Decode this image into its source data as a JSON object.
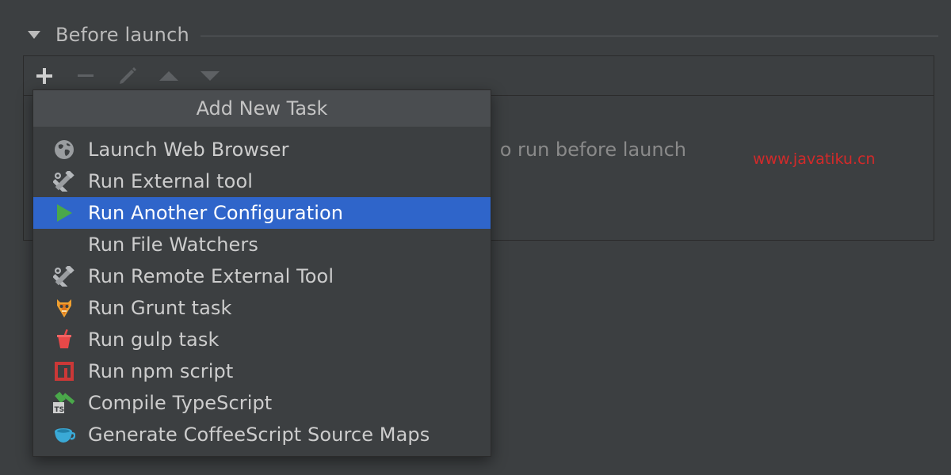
{
  "section": {
    "title": "Before launch",
    "toggle_icon": "triangle-down-icon"
  },
  "toolbar": {
    "buttons": [
      {
        "name": "add-task-button",
        "icon": "plus-icon"
      },
      {
        "name": "remove-task-button",
        "icon": "minus-icon"
      },
      {
        "name": "edit-task-button",
        "icon": "pencil-icon"
      },
      {
        "name": "move-up-button",
        "icon": "arrow-up-icon"
      },
      {
        "name": "move-down-button",
        "icon": "arrow-down-icon"
      }
    ]
  },
  "panel": {
    "empty_message": "o run before launch"
  },
  "watermark": {
    "text": "www.javatiku.cn"
  },
  "popup": {
    "title": "Add New Task",
    "items": [
      {
        "label": "Launch Web Browser",
        "icon": "globe-icon",
        "selected": false
      },
      {
        "label": "Run External tool",
        "icon": "tools-icon",
        "selected": false
      },
      {
        "label": "Run Another Configuration",
        "icon": "run-icon",
        "selected": true
      },
      {
        "label": "Run File Watchers",
        "icon": "",
        "selected": false
      },
      {
        "label": "Run Remote External Tool",
        "icon": "tools-icon",
        "selected": false
      },
      {
        "label": "Run Grunt task",
        "icon": "grunt-icon",
        "selected": false
      },
      {
        "label": "Run gulp task",
        "icon": "gulp-icon",
        "selected": false
      },
      {
        "label": "Run npm script",
        "icon": "npm-icon",
        "selected": false
      },
      {
        "label": "Compile TypeScript",
        "icon": "typescript-icon",
        "selected": false
      },
      {
        "label": "Generate CoffeeScript Source Maps",
        "icon": "coffeescript-icon",
        "selected": false
      }
    ]
  },
  "colors": {
    "background": "#3c3f41",
    "selection": "#2f65ca",
    "run_green": "#4aa84a",
    "watermark_red": "#d22a2a"
  }
}
